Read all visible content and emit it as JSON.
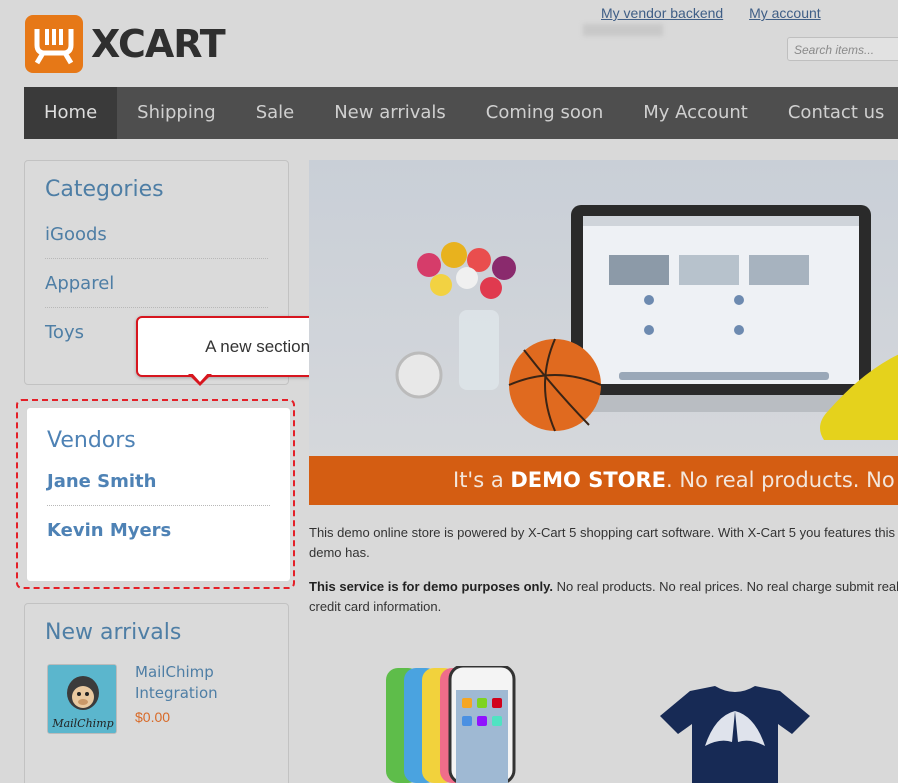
{
  "header": {
    "logo_text": "XCART",
    "vendor_backend_link": "My vendor backend",
    "my_account_link": "My account",
    "search_placeholder": "Search items..."
  },
  "nav": {
    "items": [
      "Home",
      "Shipping",
      "Sale",
      "New arrivals",
      "Coming soon",
      "My Account",
      "Contact us"
    ]
  },
  "categories": {
    "title": "Categories",
    "items": [
      "iGoods",
      "Apparel",
      "Toys"
    ]
  },
  "callout": {
    "text": "A new section with a list of vendors"
  },
  "vendors": {
    "title": "Vendors",
    "items": [
      "Jane Smith",
      "Kevin Myers"
    ]
  },
  "new_arrivals": {
    "title": "New arrivals",
    "product_name": "MailChimp Integration",
    "product_price": "$0.00",
    "thumb_label": "MailChimp"
  },
  "banner": {
    "prefix": "It's a",
    "emphasis": "DEMO STORE",
    "suffix": ". No real products. No"
  },
  "content": {
    "para1": "This demo online store is powered by X-Cart 5 shopping cart software. With X-Cart 5 you features this demo has.",
    "para2_bold": "This service is for demo purposes only.",
    "para2_rest": " No real products. No real prices. No real charge submit real credit card information."
  },
  "colors": {
    "accent_orange": "#e67817",
    "nav_bg": "#4e4e4e",
    "link_blue": "#4e7ea5",
    "callout_red": "#d7161f",
    "banner_strip": "#d45d12"
  }
}
